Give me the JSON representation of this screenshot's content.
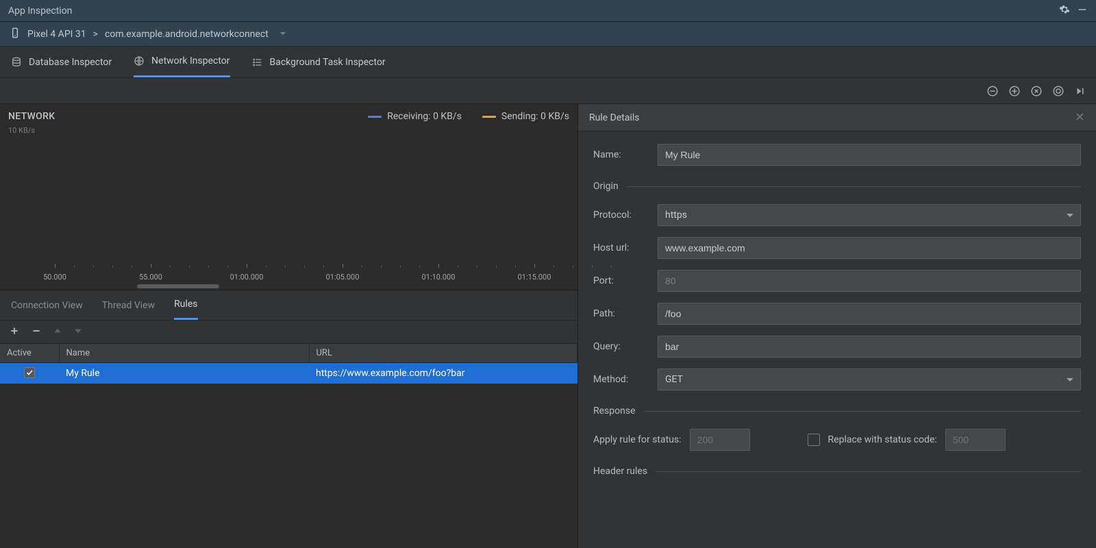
{
  "title": "App Inspection",
  "breadcrumb": {
    "device": "Pixel 4 API 31",
    "sep": ">",
    "app": "com.example.android.networkconnect"
  },
  "tabs": {
    "db": "Database Inspector",
    "net": "Network Inspector",
    "bg": "Background Task Inspector"
  },
  "chart": {
    "label": "NETWORK",
    "ylabel": "10 KB/s",
    "recv": "Receiving: 0 KB/s",
    "send": "Sending: 0 KB/s"
  },
  "chart_data": {
    "type": "line",
    "title": "NETWORK",
    "ylabel": "KB/s",
    "ylim": [
      0,
      10
    ],
    "x_ticks": [
      "50.000",
      "55.000",
      "01:00.000",
      "01:05.000",
      "01:10.000",
      "01:15.000"
    ],
    "series": [
      {
        "name": "Receiving",
        "color": "#4f7fd9",
        "unit": "KB/s",
        "current": 0
      },
      {
        "name": "Sending",
        "color": "#e2a23b",
        "unit": "KB/s",
        "current": 0
      }
    ]
  },
  "rules_tabs": {
    "conn": "Connection View",
    "thread": "Thread View",
    "rules": "Rules"
  },
  "rules_table": {
    "headers": {
      "active": "Active",
      "name": "Name",
      "url": "URL"
    },
    "row": {
      "name": "My Rule",
      "url": "https://www.example.com/foo?bar",
      "active": true
    }
  },
  "details": {
    "title": "Rule Details",
    "name_label": "Name:",
    "name_value": "My Rule",
    "origin_section": "Origin",
    "protocol_label": "Protocol:",
    "protocol_value": "https",
    "host_label": "Host url:",
    "host_value": "www.example.com",
    "port_label": "Port:",
    "port_placeholder": "80",
    "path_label": "Path:",
    "path_value": "/foo",
    "query_label": "Query:",
    "query_value": "bar",
    "method_label": "Method:",
    "method_value": "GET",
    "response_section": "Response",
    "apply_label": "Apply rule for status:",
    "apply_placeholder": "200",
    "replace_label": "Replace with status code:",
    "replace_placeholder": "500",
    "header_rules_section": "Header rules"
  }
}
